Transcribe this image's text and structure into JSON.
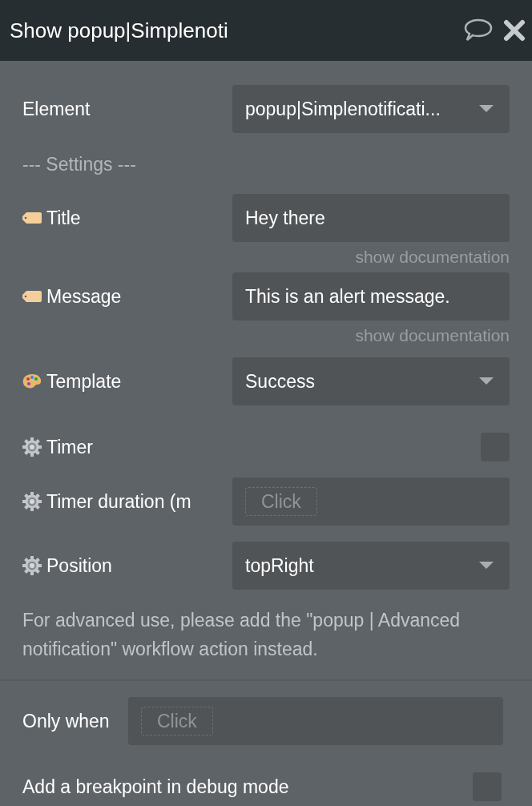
{
  "window": {
    "title": "Show popup|Simplenoti"
  },
  "element": {
    "label": "Element",
    "value": "popup|Simplenotificati..."
  },
  "settings_heading": "--- Settings ---",
  "params": [
    {
      "kind": "text",
      "label": "Title",
      "value": "Hey there",
      "doc_link": "show documentation"
    },
    {
      "kind": "text",
      "label": "Message",
      "value": "This is an alert message.",
      "doc_link": "show documentation"
    },
    {
      "kind": "dropdown",
      "label": "Template",
      "value": "Success"
    },
    {
      "kind": "checkbox",
      "label": "Timer",
      "checked": false
    },
    {
      "kind": "expression",
      "label": "Timer duration (m",
      "placeholder": "Click"
    },
    {
      "kind": "dropdown",
      "label": "Position",
      "value": "topRight"
    }
  ],
  "note": "For advanced use, please add the \"popup | Advanced notification\" workflow action instead.",
  "only_when": {
    "label": "Only when",
    "placeholder": "Click"
  },
  "breakpoint": {
    "label": "Add a breakpoint in debug mode",
    "checked": false
  }
}
